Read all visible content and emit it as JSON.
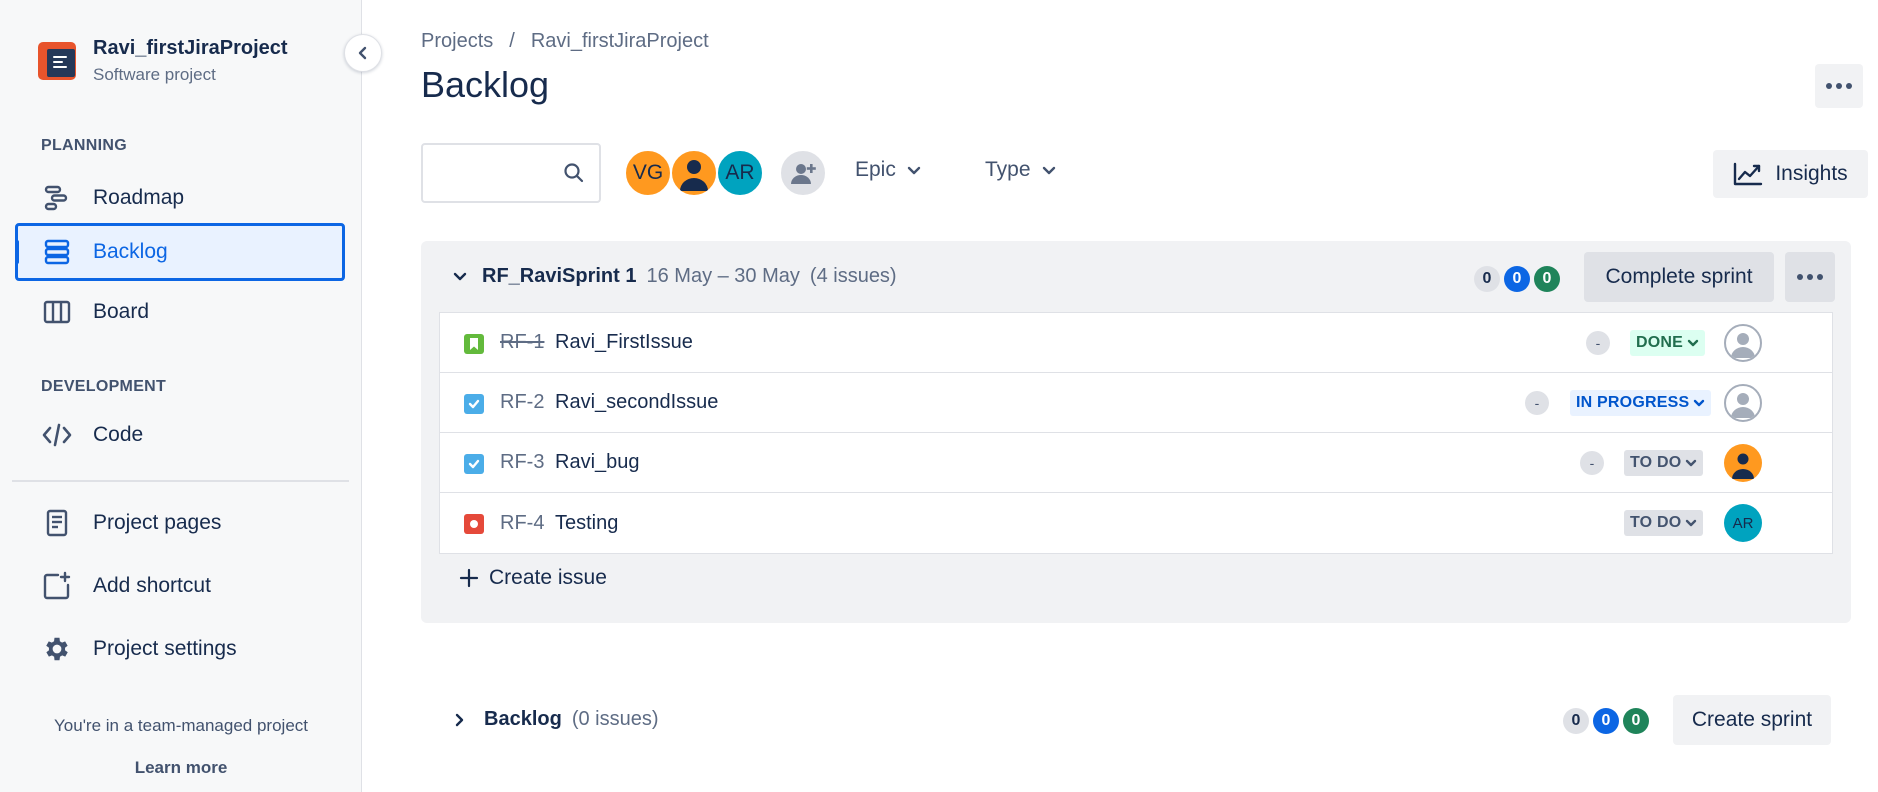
{
  "project": {
    "name": "Ravi_firstJiraProject",
    "type": "Software project"
  },
  "sidebar": {
    "planning_title": "PLANNING",
    "planning_items": [
      {
        "label": "Roadmap",
        "icon": "roadmap-icon"
      },
      {
        "label": "Backlog",
        "icon": "backlog-icon",
        "active": true
      },
      {
        "label": "Board",
        "icon": "board-icon"
      }
    ],
    "development_title": "DEVELOPMENT",
    "development_items": [
      {
        "label": "Code",
        "icon": "code-icon"
      }
    ],
    "other_items": [
      {
        "label": "Project pages",
        "icon": "pages-icon"
      },
      {
        "label": "Add shortcut",
        "icon": "add-shortcut-icon"
      },
      {
        "label": "Project settings",
        "icon": "gear-icon"
      }
    ],
    "footer_text": "You're in a team-managed project",
    "learn_more": "Learn more"
  },
  "breadcrumb": {
    "projects": "Projects",
    "separator": "/",
    "project": "Ravi_firstJiraProject"
  },
  "page_title": "Backlog",
  "toolbar": {
    "search_placeholder": "",
    "avatars": [
      {
        "initials": "VG",
        "color": "#ff991f"
      },
      {
        "initials": "",
        "color": "#ff991f",
        "icon": "person-icon"
      },
      {
        "initials": "AR",
        "color": "#00a3bf"
      }
    ],
    "epic_label": "Epic",
    "type_label": "Type",
    "insights_label": "Insights"
  },
  "sprint": {
    "name": "RF_RaviSprint 1",
    "dates": "16 May – 30 May",
    "issue_count": "(4 issues)",
    "counts": {
      "todo": "0",
      "in_progress": "0",
      "done": "0"
    },
    "complete_label": "Complete sprint",
    "issues": [
      {
        "key": "RF-1",
        "summary": "Ravi_FirstIssue",
        "type": "story",
        "estimate": "-",
        "status": "DONE",
        "assignee": "unassigned"
      },
      {
        "key": "RF-2",
        "summary": "Ravi_secondIssue",
        "type": "task",
        "estimate": "-",
        "status": "IN PROGRESS",
        "assignee": "unassigned"
      },
      {
        "key": "RF-3",
        "summary": "Ravi_bug",
        "type": "task",
        "estimate": "-",
        "status": "TO DO",
        "assignee": "person"
      },
      {
        "key": "RF-4",
        "summary": "Testing",
        "type": "bug",
        "estimate": "",
        "status": "TO DO",
        "assignee": "AR"
      }
    ],
    "create_issue_label": "Create issue"
  },
  "backlog": {
    "title": "Backlog",
    "issue_count": "(0 issues)",
    "counts": {
      "todo": "0",
      "in_progress": "0",
      "done": "0"
    },
    "create_sprint_label": "Create sprint"
  },
  "colors": {
    "accent": "#0c66e4",
    "story": "#63ba3c",
    "task": "#4bade8",
    "bug": "#e5493a"
  }
}
